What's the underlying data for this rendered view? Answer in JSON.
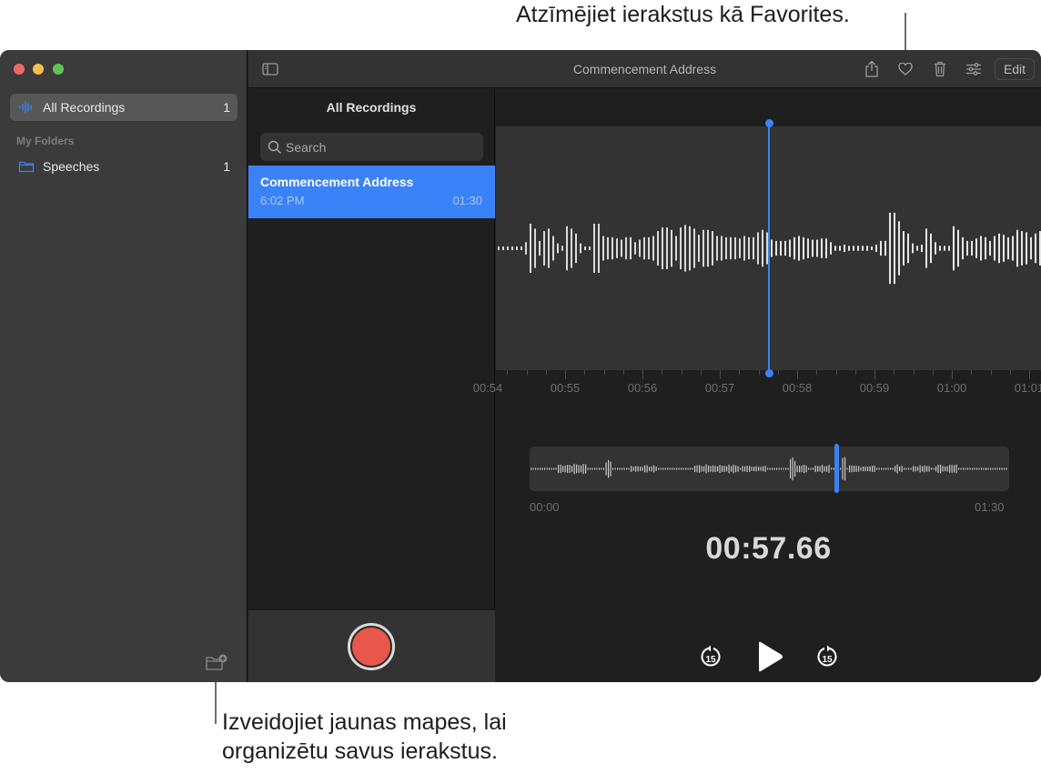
{
  "callouts": {
    "favorites": "Atzīmējiet ierakstus kā Favorites.",
    "new_folder": "Izveidojiet jaunas mapes, lai organizētu savus ierakstus."
  },
  "window": {
    "title": "Commencement Address",
    "traffic_lights": [
      "close",
      "minimize",
      "zoom"
    ]
  },
  "sidebar": {
    "items": [
      {
        "label": "All Recordings",
        "count": "1",
        "icon": "waveform-icon",
        "active": true
      }
    ],
    "folders_header": "My Folders",
    "folders": [
      {
        "label": "Speeches",
        "count": "1",
        "icon": "folder-icon"
      }
    ],
    "new_folder_icon": "new-folder-icon"
  },
  "toolbar": {
    "sidebar_toggle_icon": "sidebar-toggle-icon",
    "share_icon": "share-icon",
    "favorite_icon": "heart-icon",
    "delete_icon": "trash-icon",
    "settings_icon": "sliders-icon",
    "edit_label": "Edit"
  },
  "list": {
    "title": "All Recordings",
    "search_placeholder": "Search",
    "recordings": [
      {
        "name": "Commencement Address",
        "time": "6:02 PM",
        "duration": "01:30",
        "selected": true
      }
    ]
  },
  "detail": {
    "ruler_labels": [
      "00:54",
      "00:55",
      "00:56",
      "00:57",
      "00:58",
      "00:59",
      "01:00",
      "01:01"
    ],
    "overview_start": "00:00",
    "overview_end": "01:30",
    "current_time": "00:57.66",
    "playback_fraction": 0.64,
    "skip_back_label": "15",
    "skip_forward_label": "15",
    "colors": {
      "accent": "#3a82f7",
      "record": "#e9574a"
    }
  }
}
